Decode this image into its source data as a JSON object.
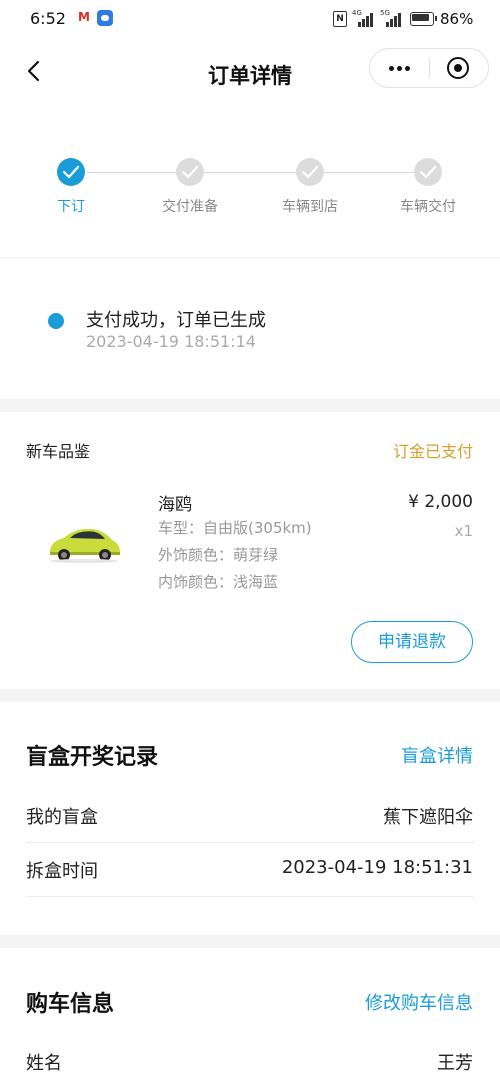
{
  "status_bar": {
    "time": "6:52",
    "battery": "86%",
    "net1": "4G",
    "net2": "5G"
  },
  "nav": {
    "title": "订单详情"
  },
  "steps": [
    {
      "label": "下订",
      "active": true
    },
    {
      "label": "交付准备",
      "active": false
    },
    {
      "label": "车辆到店",
      "active": false
    },
    {
      "label": "车辆交付",
      "active": false
    }
  ],
  "payment": {
    "status": "支付成功，订单已生成",
    "time": "2023-04-19 18:51:14"
  },
  "order": {
    "title": "新车品鉴",
    "status": "订金已支付",
    "product_name": "海鸥",
    "model": "车型：自由版(305km)",
    "exterior": "外饰颜色：萌芽绿",
    "interior": "内饰颜色：浅海蓝",
    "price": "¥ 2,000",
    "quantity": "x1",
    "refund_button": "申请退款"
  },
  "blind_box": {
    "title": "盲盒开奖记录",
    "link": "盲盒详情",
    "rows": [
      {
        "label": "我的盲盒",
        "value": "蕉下遮阳伞"
      },
      {
        "label": "拆盒时间",
        "value": "2023-04-19 18:51:31"
      }
    ]
  },
  "purchase": {
    "title": "购车信息",
    "link": "修改购车信息",
    "rows": [
      {
        "label": "姓名",
        "value": "王芳"
      }
    ]
  },
  "colors": {
    "accent": "#1a9cd8",
    "paid": "#d6a02d",
    "car": "#c9dc3c"
  }
}
